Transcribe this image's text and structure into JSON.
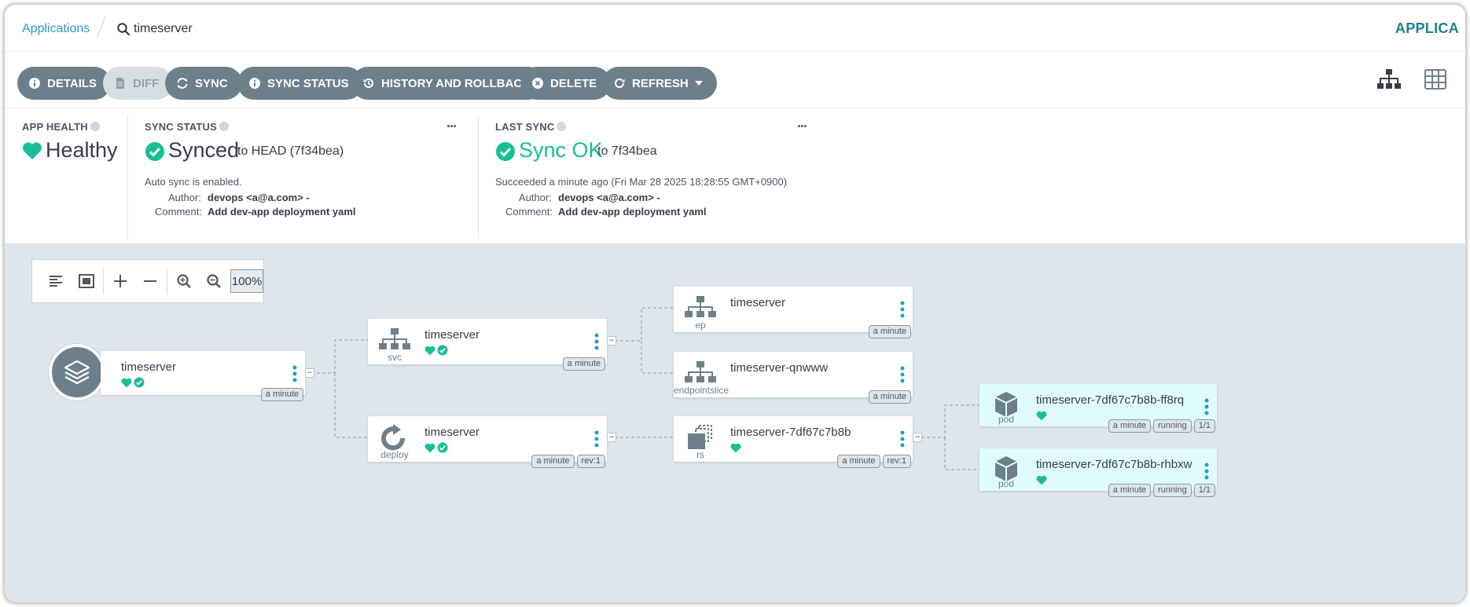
{
  "breadcrumb": {
    "root": "Applications",
    "current": "timeserver"
  },
  "top_right_label": "APPLICA",
  "toolbar": {
    "buttons": [
      {
        "label": "DETAILS",
        "icon": "info-circle-icon",
        "disabled": false
      },
      {
        "label": "DIFF",
        "icon": "file-icon",
        "disabled": true
      },
      {
        "label": "SYNC",
        "icon": "sync-icon",
        "disabled": false
      },
      {
        "label": "SYNC STATUS",
        "icon": "info-circle-icon",
        "disabled": false
      },
      {
        "label": "HISTORY AND ROLLBACK",
        "icon": "history-icon",
        "disabled": false
      },
      {
        "label": "DELETE",
        "icon": "times-circle-icon",
        "disabled": false
      },
      {
        "label": "REFRESH",
        "icon": "redo-icon",
        "disabled": false
      }
    ],
    "view_icons": [
      "tree-view-icon",
      "grid-view-icon"
    ]
  },
  "app_health": {
    "label": "APP HEALTH",
    "value": "Healthy"
  },
  "sync_status": {
    "label": "SYNC STATUS",
    "value": "Synced",
    "target": "to HEAD (7f34bea)",
    "auto_sync": "Auto sync is enabled.",
    "author_label": "Author:",
    "author": "devops <a@a.com> -",
    "comment_label": "Comment:",
    "comment": "Add dev-app deployment yaml",
    "more": "..."
  },
  "last_sync": {
    "label": "LAST SYNC",
    "value": "Sync OK",
    "target": "to 7f34bea",
    "succeeded": "Succeeded a minute ago (Fri Mar 28 2025 18:28:55 GMT+0900)",
    "author_label": "Author:",
    "author": "devops <a@a.com> -",
    "comment_label": "Comment:",
    "comment": "Add dev-app deployment yaml",
    "more": "..."
  },
  "zoom": {
    "level": "100%"
  },
  "colors": {
    "healthy": "#18be94",
    "button": "#6d7f8b",
    "link": "#2a9bb8"
  },
  "nodes": {
    "app": {
      "name": "timeserver",
      "tags": [
        "a minute"
      ]
    },
    "svc": {
      "name": "timeserver",
      "kind": "svc",
      "tags": [
        "a minute"
      ]
    },
    "deploy": {
      "name": "timeserver",
      "kind": "deploy",
      "tags": [
        "a minute",
        "rev:1"
      ]
    },
    "ep": {
      "name": "timeserver",
      "kind": "ep",
      "tags": [
        "a minute"
      ]
    },
    "endpointslice": {
      "name": "timeserver-qnwww",
      "kind": "endpointslice",
      "tags": [
        "a minute"
      ]
    },
    "rs": {
      "name": "timeserver-7df67c7b8b",
      "kind": "rs",
      "tags": [
        "a minute",
        "rev:1"
      ]
    },
    "pod1": {
      "name": "timeserver-7df67c7b8b-ff8rq",
      "kind": "pod",
      "tags": [
        "a minute",
        "running",
        "1/1"
      ]
    },
    "pod2": {
      "name": "timeserver-7df67c7b8b-rhbxw",
      "kind": "pod",
      "tags": [
        "a minute",
        "running",
        "1/1"
      ]
    }
  }
}
